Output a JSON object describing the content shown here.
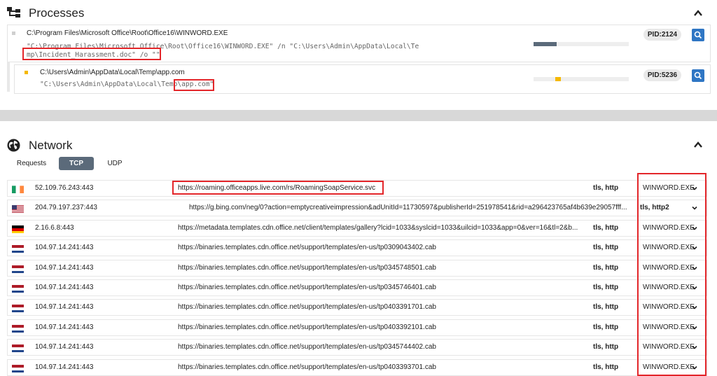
{
  "processes": {
    "title": "Processes",
    "items": [
      {
        "path": "C:\\Program Files\\Microsoft Office\\Root\\Office16\\WINWORD.EXE",
        "cmd_line1": "\"C:\\Program Files\\Microsoft Office\\Root\\Office16\\WINWORD.EXE\" /n \"C:\\Users\\Admin\\AppData\\Local\\Te",
        "cmd_line2": "mp\\Incident_Harassment.doc\" /o \"\"",
        "pid": "PID:2124",
        "indicator_color": "#cfcfcf",
        "bar_color": "#5b6a7a",
        "bar_fill": 0.24
      },
      {
        "path": "C:\\Users\\Admin\\AppData\\Local\\Temp\\app.com",
        "cmd_line1": "\"C:\\Users\\Admin\\AppData\\Local\\Temp\\app.com\"",
        "pid": "PID:5236",
        "indicator_color": "#f5b800",
        "bar_color": "#f5b800"
      }
    ]
  },
  "network": {
    "title": "Network",
    "tabs": [
      {
        "label": "Requests",
        "active": false
      },
      {
        "label": "TCP",
        "active": true
      },
      {
        "label": "UDP",
        "active": false
      }
    ],
    "rows": [
      {
        "flag": "ireland",
        "ip": "52.109.76.243:443",
        "url": "https://roaming.officeapps.live.com/rs/RoamingSoapService.svc",
        "proto": "tls, http",
        "process": "WINWORD.EXE"
      },
      {
        "flag": "usa",
        "ip": "204.79.197.237:443",
        "url": "https://g.bing.com/neg/0?action=emptycreativeimpression&adUnitId=11730597&publisherId=251978541&rid=a296423765af4b639e29057fff...",
        "proto": "tls, http2",
        "process": ""
      },
      {
        "flag": "germany",
        "ip": "2.16.6.8:443",
        "url": "https://metadata.templates.cdn.office.net/client/templates/gallery?lcid=1033&syslcid=1033&uilcid=1033&app=0&ver=16&tl=2&b...",
        "proto": "tls, http",
        "process": "WINWORD.EXE"
      },
      {
        "flag": "netherlands",
        "ip": "104.97.14.241:443",
        "url": "https://binaries.templates.cdn.office.net/support/templates/en-us/tp0309043402.cab",
        "proto": "tls, http",
        "process": "WINWORD.EXE"
      },
      {
        "flag": "netherlands",
        "ip": "104.97.14.241:443",
        "url": "https://binaries.templates.cdn.office.net/support/templates/en-us/tp0345748501.cab",
        "proto": "tls, http",
        "process": "WINWORD.EXE"
      },
      {
        "flag": "netherlands",
        "ip": "104.97.14.241:443",
        "url": "https://binaries.templates.cdn.office.net/support/templates/en-us/tp0345746401.cab",
        "proto": "tls, http",
        "process": "WINWORD.EXE"
      },
      {
        "flag": "netherlands",
        "ip": "104.97.14.241:443",
        "url": "https://binaries.templates.cdn.office.net/support/templates/en-us/tp0403391701.cab",
        "proto": "tls, http",
        "process": "WINWORD.EXE"
      },
      {
        "flag": "netherlands",
        "ip": "104.97.14.241:443",
        "url": "https://binaries.templates.cdn.office.net/support/templates/en-us/tp0403392101.cab",
        "proto": "tls, http",
        "process": "WINWORD.EXE"
      },
      {
        "flag": "netherlands",
        "ip": "104.97.14.241:443",
        "url": "https://binaries.templates.cdn.office.net/support/templates/en-us/tp0345744402.cab",
        "proto": "tls, http",
        "process": "WINWORD.EXE"
      },
      {
        "flag": "netherlands",
        "ip": "104.97.14.241:443",
        "url": "https://binaries.templates.cdn.office.net/support/templates/en-us/tp0403393701.cab",
        "proto": "tls, http",
        "process": "WINWORD.EXE"
      }
    ]
  },
  "colors": {
    "highlight": "#e3262a",
    "search_button": "#2f76c4",
    "active_tab": "#5b6a7a"
  }
}
